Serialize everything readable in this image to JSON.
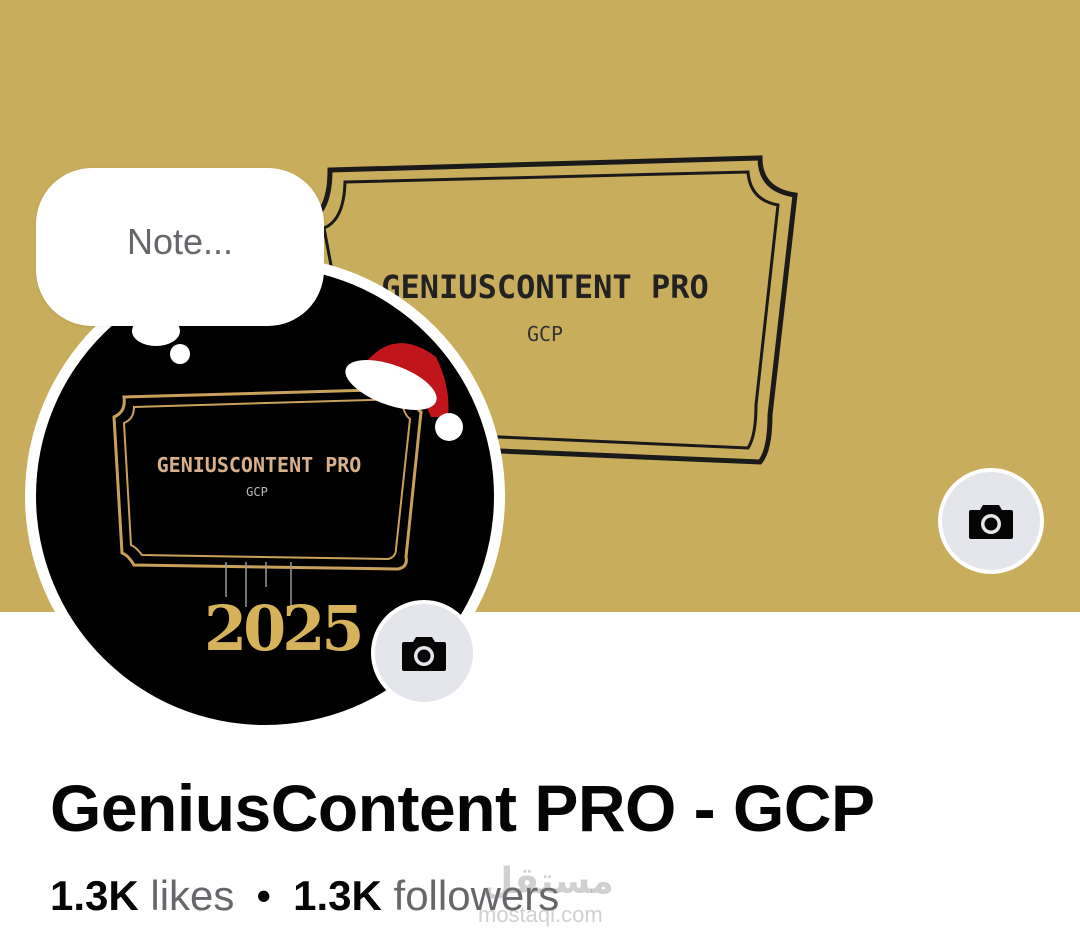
{
  "cover": {
    "title": "GENIUSCONTENT PRO",
    "subtitle": "GCP",
    "camera_icon": "camera-icon",
    "bg_color": "#c8ad5c"
  },
  "avatar": {
    "title": "GENIUSCONTENT PRO",
    "subtitle": "GCP",
    "year": "2025",
    "camera_icon": "camera-icon"
  },
  "note": {
    "placeholder": "Note..."
  },
  "page": {
    "name": "GeniusContent PRO - GCP",
    "likes_count": "1.3K",
    "likes_label": "likes",
    "separator": "•",
    "followers_count": "1.3K",
    "followers_label": "followers"
  },
  "watermark": {
    "text": "مستقل",
    "sub": "mostaql.com"
  }
}
